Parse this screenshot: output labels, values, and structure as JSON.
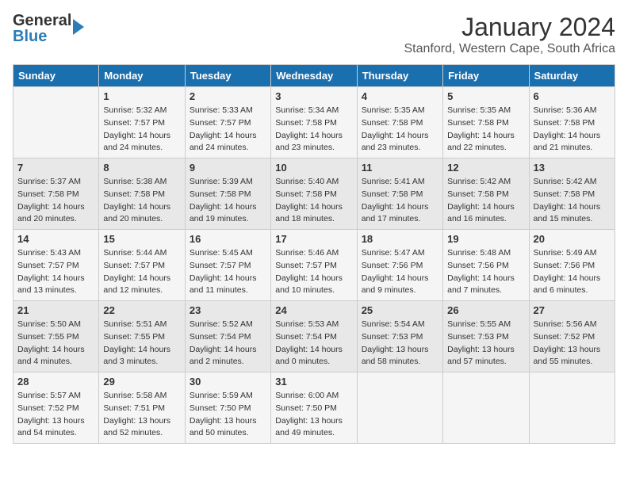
{
  "header": {
    "logo_general": "General",
    "logo_blue": "Blue",
    "month_title": "January 2024",
    "location": "Stanford, Western Cape, South Africa"
  },
  "days_of_week": [
    "Sunday",
    "Monday",
    "Tuesday",
    "Wednesday",
    "Thursday",
    "Friday",
    "Saturday"
  ],
  "weeks": [
    [
      {
        "day": "",
        "info": ""
      },
      {
        "day": "1",
        "info": "Sunrise: 5:32 AM\nSunset: 7:57 PM\nDaylight: 14 hours\nand 24 minutes."
      },
      {
        "day": "2",
        "info": "Sunrise: 5:33 AM\nSunset: 7:57 PM\nDaylight: 14 hours\nand 24 minutes."
      },
      {
        "day": "3",
        "info": "Sunrise: 5:34 AM\nSunset: 7:58 PM\nDaylight: 14 hours\nand 23 minutes."
      },
      {
        "day": "4",
        "info": "Sunrise: 5:35 AM\nSunset: 7:58 PM\nDaylight: 14 hours\nand 23 minutes."
      },
      {
        "day": "5",
        "info": "Sunrise: 5:35 AM\nSunset: 7:58 PM\nDaylight: 14 hours\nand 22 minutes."
      },
      {
        "day": "6",
        "info": "Sunrise: 5:36 AM\nSunset: 7:58 PM\nDaylight: 14 hours\nand 21 minutes."
      }
    ],
    [
      {
        "day": "7",
        "info": "Sunrise: 5:37 AM\nSunset: 7:58 PM\nDaylight: 14 hours\nand 20 minutes."
      },
      {
        "day": "8",
        "info": "Sunrise: 5:38 AM\nSunset: 7:58 PM\nDaylight: 14 hours\nand 20 minutes."
      },
      {
        "day": "9",
        "info": "Sunrise: 5:39 AM\nSunset: 7:58 PM\nDaylight: 14 hours\nand 19 minutes."
      },
      {
        "day": "10",
        "info": "Sunrise: 5:40 AM\nSunset: 7:58 PM\nDaylight: 14 hours\nand 18 minutes."
      },
      {
        "day": "11",
        "info": "Sunrise: 5:41 AM\nSunset: 7:58 PM\nDaylight: 14 hours\nand 17 minutes."
      },
      {
        "day": "12",
        "info": "Sunrise: 5:42 AM\nSunset: 7:58 PM\nDaylight: 14 hours\nand 16 minutes."
      },
      {
        "day": "13",
        "info": "Sunrise: 5:42 AM\nSunset: 7:58 PM\nDaylight: 14 hours\nand 15 minutes."
      }
    ],
    [
      {
        "day": "14",
        "info": "Sunrise: 5:43 AM\nSunset: 7:57 PM\nDaylight: 14 hours\nand 13 minutes."
      },
      {
        "day": "15",
        "info": "Sunrise: 5:44 AM\nSunset: 7:57 PM\nDaylight: 14 hours\nand 12 minutes."
      },
      {
        "day": "16",
        "info": "Sunrise: 5:45 AM\nSunset: 7:57 PM\nDaylight: 14 hours\nand 11 minutes."
      },
      {
        "day": "17",
        "info": "Sunrise: 5:46 AM\nSunset: 7:57 PM\nDaylight: 14 hours\nand 10 minutes."
      },
      {
        "day": "18",
        "info": "Sunrise: 5:47 AM\nSunset: 7:56 PM\nDaylight: 14 hours\nand 9 minutes."
      },
      {
        "day": "19",
        "info": "Sunrise: 5:48 AM\nSunset: 7:56 PM\nDaylight: 14 hours\nand 7 minutes."
      },
      {
        "day": "20",
        "info": "Sunrise: 5:49 AM\nSunset: 7:56 PM\nDaylight: 14 hours\nand 6 minutes."
      }
    ],
    [
      {
        "day": "21",
        "info": "Sunrise: 5:50 AM\nSunset: 7:55 PM\nDaylight: 14 hours\nand 4 minutes."
      },
      {
        "day": "22",
        "info": "Sunrise: 5:51 AM\nSunset: 7:55 PM\nDaylight: 14 hours\nand 3 minutes."
      },
      {
        "day": "23",
        "info": "Sunrise: 5:52 AM\nSunset: 7:54 PM\nDaylight: 14 hours\nand 2 minutes."
      },
      {
        "day": "24",
        "info": "Sunrise: 5:53 AM\nSunset: 7:54 PM\nDaylight: 14 hours\nand 0 minutes."
      },
      {
        "day": "25",
        "info": "Sunrise: 5:54 AM\nSunset: 7:53 PM\nDaylight: 13 hours\nand 58 minutes."
      },
      {
        "day": "26",
        "info": "Sunrise: 5:55 AM\nSunset: 7:53 PM\nDaylight: 13 hours\nand 57 minutes."
      },
      {
        "day": "27",
        "info": "Sunrise: 5:56 AM\nSunset: 7:52 PM\nDaylight: 13 hours\nand 55 minutes."
      }
    ],
    [
      {
        "day": "28",
        "info": "Sunrise: 5:57 AM\nSunset: 7:52 PM\nDaylight: 13 hours\nand 54 minutes."
      },
      {
        "day": "29",
        "info": "Sunrise: 5:58 AM\nSunset: 7:51 PM\nDaylight: 13 hours\nand 52 minutes."
      },
      {
        "day": "30",
        "info": "Sunrise: 5:59 AM\nSunset: 7:50 PM\nDaylight: 13 hours\nand 50 minutes."
      },
      {
        "day": "31",
        "info": "Sunrise: 6:00 AM\nSunset: 7:50 PM\nDaylight: 13 hours\nand 49 minutes."
      },
      {
        "day": "",
        "info": ""
      },
      {
        "day": "",
        "info": ""
      },
      {
        "day": "",
        "info": ""
      }
    ]
  ]
}
